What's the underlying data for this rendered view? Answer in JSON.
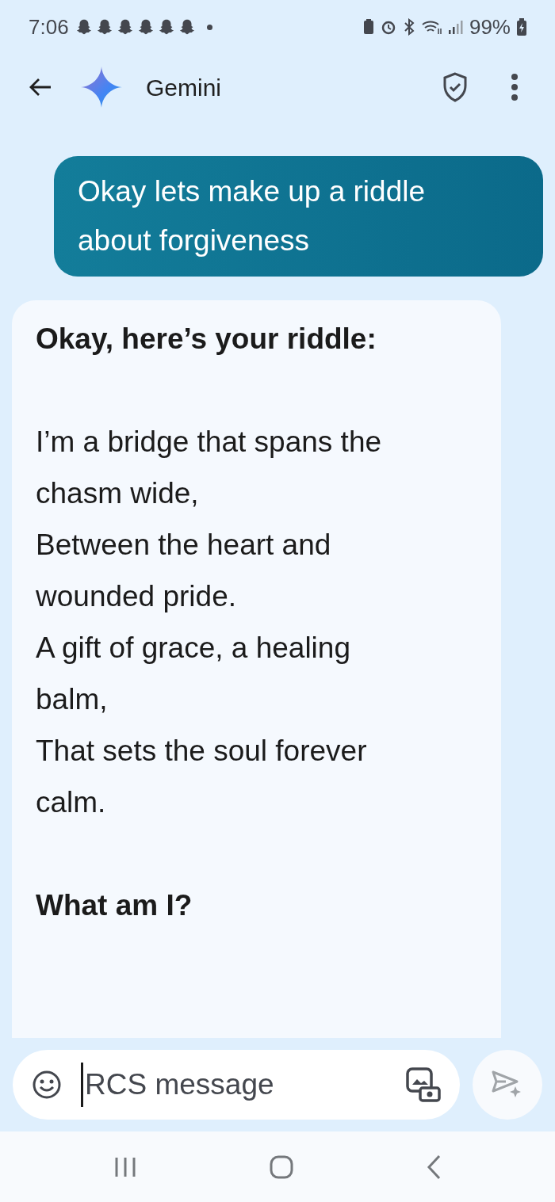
{
  "status_bar": {
    "time": "7:06",
    "notifications": [
      {
        "kind": "ghost"
      },
      {
        "kind": "ghost"
      },
      {
        "kind": "ghost"
      },
      {
        "kind": "ghost"
      },
      {
        "kind": "ghost"
      },
      {
        "kind": "ghost"
      }
    ],
    "battery": "99%"
  },
  "header": {
    "title": "Gemini"
  },
  "messages": [
    {
      "kind": "user",
      "lines": [
        "Okay lets make up a riddle about forgiveness"
      ]
    },
    {
      "kind": "bot",
      "lines": [
        {
          "kind": "bold",
          "text": "Okay, here’s your riddle:"
        },
        {
          "kind": "gap"
        },
        {
          "kind": "plain",
          "text": "I’m a bridge that spans the chasm wide,"
        },
        {
          "kind": "plain",
          "text": "Between the heart and wounded pride."
        },
        {
          "kind": "plain",
          "text": "A gift of grace, a healing balm,"
        },
        {
          "kind": "plain",
          "text": "That sets the soul forever calm."
        },
        {
          "kind": "gap"
        },
        {
          "kind": "bold",
          "text": "What am I?"
        }
      ]
    }
  ],
  "composer": {
    "placeholder": "RCS message"
  }
}
